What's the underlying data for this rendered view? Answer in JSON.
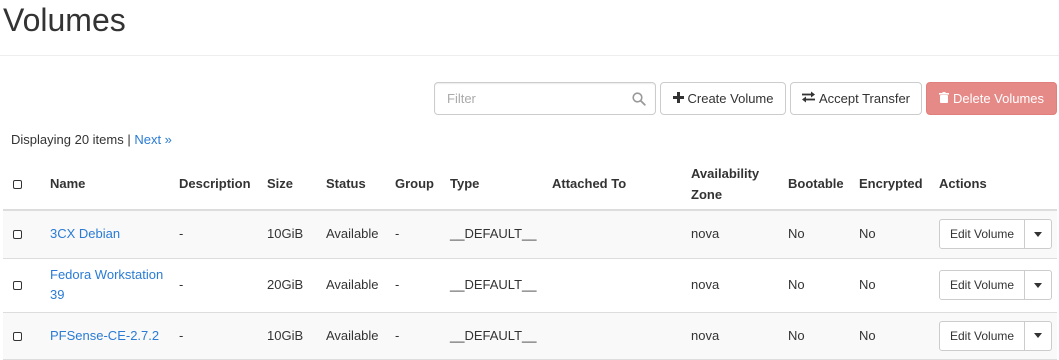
{
  "page": {
    "title": "Volumes"
  },
  "toolbar": {
    "filter_placeholder": "Filter",
    "create_label": "Create Volume",
    "transfer_label": "Accept Transfer",
    "delete_label": "Delete Volumes"
  },
  "summary": {
    "text": "Displaying 20 items | ",
    "next_label": "Next »"
  },
  "table": {
    "headers": {
      "name": "Name",
      "description": "Description",
      "size": "Size",
      "status": "Status",
      "group": "Group",
      "type": "Type",
      "attached_to": "Attached To",
      "availability_zone_1": "Availability",
      "availability_zone_2": "Zone",
      "bootable": "Bootable",
      "encrypted": "Encrypted",
      "actions": "Actions"
    },
    "rows": [
      {
        "name": "3CX Debian",
        "description": "-",
        "size": "10GiB",
        "status": "Available",
        "group": "-",
        "type": "__DEFAULT__",
        "attached_to": "",
        "zone": "nova",
        "bootable": "No",
        "encrypted": "No",
        "action": "Edit Volume"
      },
      {
        "name": "Fedora Workstation 39",
        "description": "-",
        "size": "20GiB",
        "status": "Available",
        "group": "-",
        "type": "__DEFAULT__",
        "attached_to": "",
        "zone": "nova",
        "bootable": "No",
        "encrypted": "No",
        "action": "Edit Volume"
      },
      {
        "name": "PFSense-CE-2.7.2",
        "description": "-",
        "size": "10GiB",
        "status": "Available",
        "group": "-",
        "type": "__DEFAULT__",
        "attached_to": "",
        "zone": "nova",
        "bootable": "No",
        "encrypted": "No",
        "action": "Edit Volume"
      }
    ]
  },
  "colors": {
    "link": "#2a7bd5",
    "danger": "#e58a87",
    "border": "#cccccc",
    "row_stripe": "#f9f9f9"
  },
  "icons": {
    "filter": "search-icon",
    "create": "plus-icon",
    "transfer": "exchange-icon",
    "delete": "trash-icon",
    "row_action": "caret-down-icon"
  }
}
